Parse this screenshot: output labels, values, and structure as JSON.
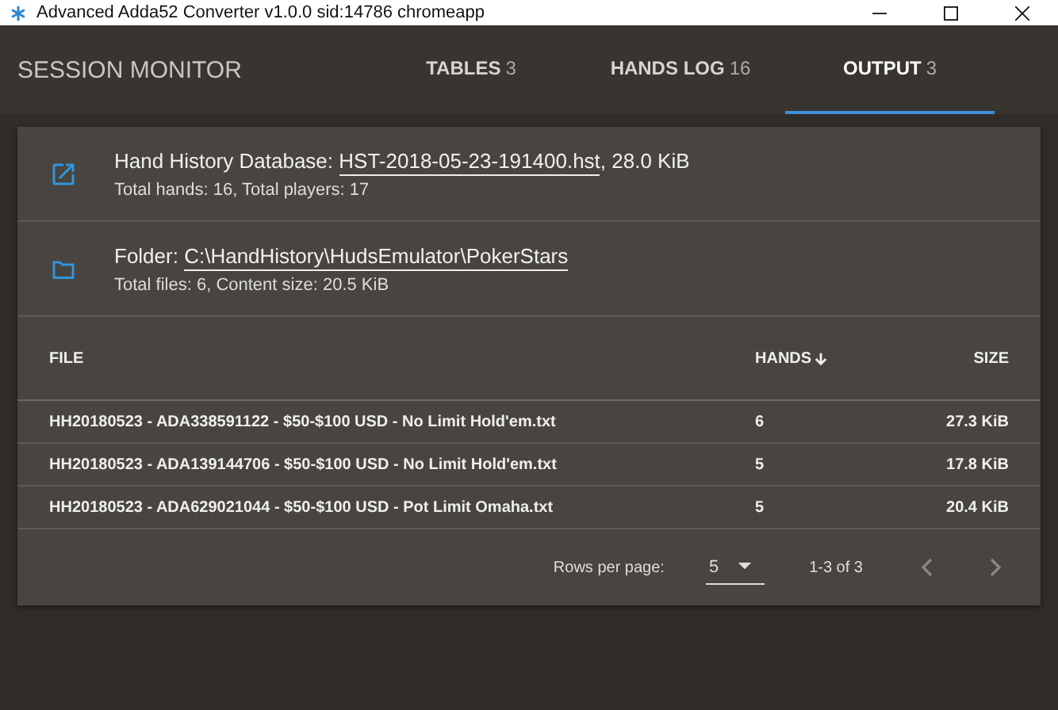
{
  "window": {
    "title": "Advanced Adda52 Converter v1.0.0 sid:14786 chromeapp"
  },
  "app_bar": {
    "title": "SESSION MONITOR"
  },
  "tabs": [
    {
      "label": "TABLES",
      "count": "3",
      "selected": false
    },
    {
      "label": "HANDS LOG",
      "count": "16",
      "selected": false
    },
    {
      "label": "OUTPUT",
      "count": "3",
      "selected": true
    }
  ],
  "outputs": [
    {
      "kind": "database",
      "label": "Hand History Database:",
      "link": "HST-2018-05-23-191400.hst",
      "suffix": ", 28.0 KiB",
      "details": "Total hands: 16, Total players: 17"
    },
    {
      "kind": "folder",
      "label": "Folder:",
      "link": "C:\\HandHistory\\HudsEmulator\\PokerStars",
      "details": "Total files: 6, Content size: 20.5 KiB"
    }
  ],
  "table": {
    "columns": [
      "FILE",
      "HANDS",
      "SIZE"
    ],
    "rows": [
      [
        "HH20180523 - ADA338591122 - $50-$100 USD - No Limit Hold'em.txt",
        "6",
        "27.3 KiB"
      ],
      [
        "HH20180523 - ADA139144706 - $50-$100 USD - No Limit Hold'em.txt",
        "5",
        "17.8 KiB"
      ],
      [
        "HH20180523 - ADA629021044 - $50-$100 USD - Pot Limit Omaha.txt",
        "5",
        "20.4 KiB"
      ]
    ]
  },
  "pagination": {
    "rows_per_page_label": "Rows per page:",
    "rows_per_page": "5",
    "range": "1-3 of 3"
  }
}
